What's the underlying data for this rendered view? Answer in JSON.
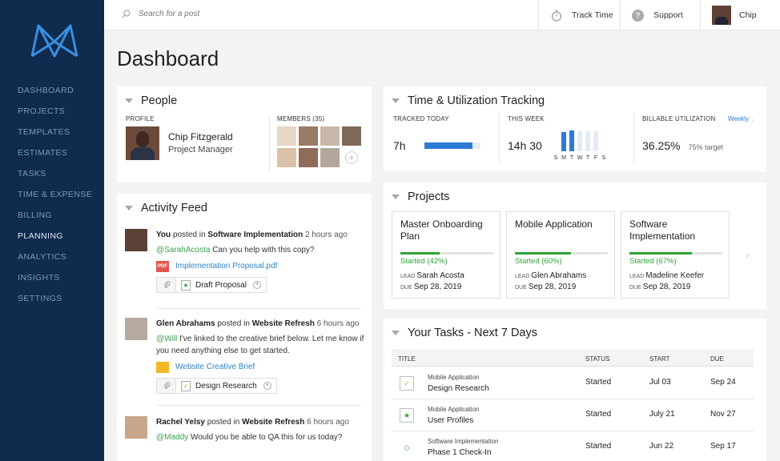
{
  "topbar": {
    "search_placeholder": "Search for a post",
    "track_time": "Track Time",
    "support": "Support",
    "user": "Chip"
  },
  "sidebar": {
    "items": [
      {
        "label": "DASHBOARD",
        "active": false
      },
      {
        "label": "PROJECTS",
        "active": false
      },
      {
        "label": "TEMPLATES",
        "active": false
      },
      {
        "label": "ESTIMATES",
        "active": false
      },
      {
        "label": "TASKS",
        "active": false
      },
      {
        "label": "TIME & EXPENSE",
        "active": false
      },
      {
        "label": "BILLING",
        "active": false
      },
      {
        "label": "PLANNING",
        "active": true
      },
      {
        "label": "ANALYTICS",
        "active": false
      },
      {
        "label": "INSIGHTS",
        "active": false
      },
      {
        "label": "SETTINGS",
        "active": false
      }
    ]
  },
  "page_title": "Dashboard",
  "people": {
    "title": "People",
    "profile_label": "PROFILE",
    "name": "Chip Fitzgerald",
    "role": "Project Manager",
    "members_label": "MEMBERS (35)"
  },
  "activity": {
    "title": "Activity Feed",
    "items": [
      {
        "actor": "You",
        "verb": "posted in",
        "project": "Software Implementation",
        "time": "2 hours ago",
        "mention": "@SarahAcosta",
        "message": "Can you help with this copy?",
        "file": "Implementation Proposal.pdf",
        "attachment": "Draft Proposal"
      },
      {
        "actor": "Glen Abrahams",
        "verb": "posted in",
        "project": "Website Refresh",
        "time": "6 hours ago",
        "mention": "@Will",
        "message": "I've linked to the creative brief below. Let me know if you need anything else to get started.",
        "file": "Website Creative Brief",
        "attachment": "Design Research"
      },
      {
        "actor": "Rachel Yelsy",
        "verb": "posted in",
        "project": "Website Refresh",
        "time": "6 hours ago",
        "mention": "@Maddy",
        "message": "Would you be able to QA this for us today?"
      }
    ]
  },
  "time_tracking": {
    "title": "Time & Utilization Tracking",
    "tracked_today_label": "TRACKED TODAY",
    "tracked_today": "7h",
    "tracked_today_fraction": 0.85,
    "this_week_label": "THIS WEEK",
    "this_week": "14h 30",
    "week_days": [
      "S",
      "M",
      "T",
      "W",
      "T",
      "F",
      "S"
    ],
    "week_levels": [
      0.0,
      0.92,
      1.0,
      0.98,
      0.98,
      0.98,
      0.0
    ],
    "week_filled": [
      false,
      true,
      true,
      false,
      false,
      false,
      false
    ],
    "billable_label": "BILLABLE UTILIZATION",
    "billable": "36.25%",
    "target": "75% target",
    "period": "Weekly"
  },
  "projects": {
    "title": "Projects",
    "lead_label": "LEAD",
    "due_label": "DUE",
    "items": [
      {
        "title": "Master Onboarding Plan",
        "status": "Started (42%)",
        "progress": 0.42,
        "lead": "Sarah Acosta",
        "due": "Sep 28, 2019"
      },
      {
        "title": "Mobile Application",
        "status": "Started (60%)",
        "progress": 0.6,
        "lead": "Glen Abrahams",
        "due": "Sep 28, 2019"
      },
      {
        "title": "Software Implementation",
        "status": "Started (67%)",
        "progress": 0.67,
        "lead": "Madeline Keefer",
        "due": "Sep 28, 2019"
      }
    ]
  },
  "tasks": {
    "title": "Your Tasks - Next 7 Days",
    "columns": {
      "title": "TITLE",
      "status": "STATUS",
      "start": "START",
      "due": "DUE"
    },
    "rows": [
      {
        "project": "Mobile Application",
        "name": "Design Research",
        "status": "Started",
        "start": "Jul 03",
        "due": "Sep 24",
        "icon": "check-icon"
      },
      {
        "project": "Mobile Application",
        "name": "User Profiles",
        "status": "Started",
        "start": "July 21",
        "due": "Nov 27",
        "icon": "star-icon"
      },
      {
        "project": "Software Implementation",
        "name": "Phase 1 Check-In",
        "status": "Started",
        "start": "Jun 22",
        "due": "Sep 17",
        "icon": "diamond-icon"
      }
    ]
  },
  "colors": {
    "sidebar_bg": "#0f2b4d",
    "accent_blue": "#2e79d4",
    "progress_green": "#2fa336",
    "mention_green": "#3aa04a"
  }
}
